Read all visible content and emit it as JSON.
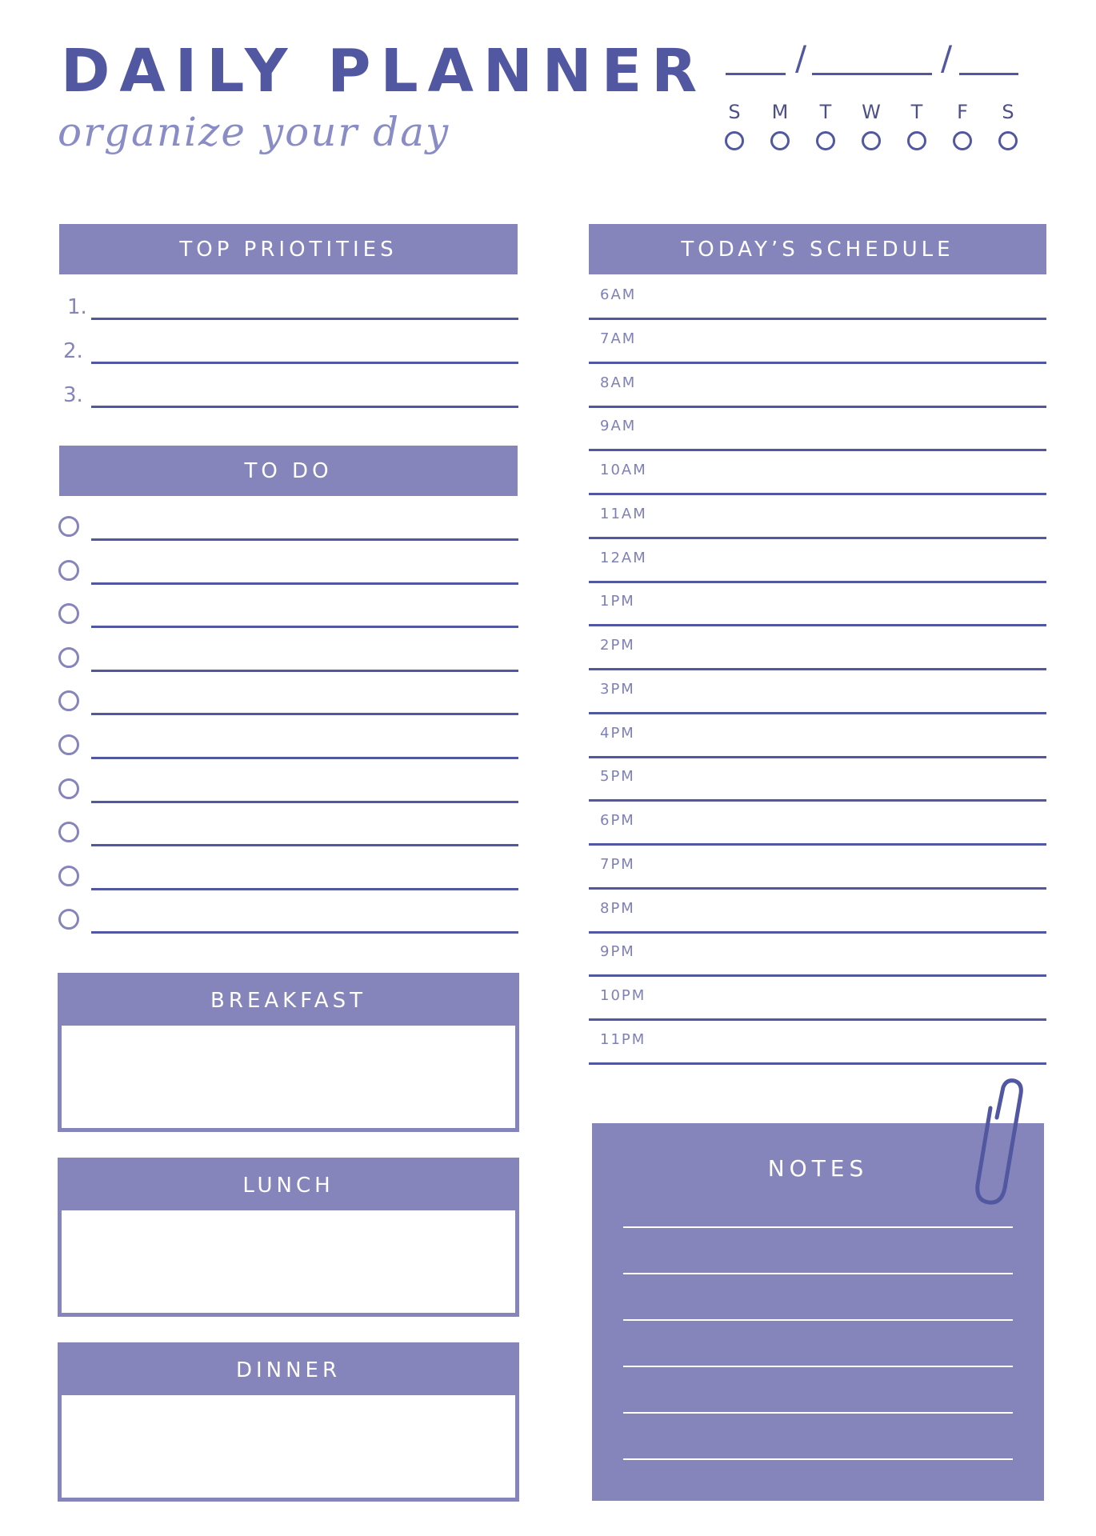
{
  "header": {
    "title": "DAILY PLANNER",
    "subtitle": "organize your day",
    "date_separators": [
      "/",
      "/"
    ],
    "weekdays": [
      "S",
      "M",
      "T",
      "W",
      "T",
      "F",
      "S"
    ]
  },
  "priorities": {
    "title": "TOP PRIOTITIES",
    "items": [
      "1.",
      "2.",
      "3."
    ]
  },
  "todo": {
    "title": "TO DO",
    "count": 10
  },
  "meals": [
    {
      "title": "BREAKFAST"
    },
    {
      "title": "LUNCH"
    },
    {
      "title": "DINNER"
    }
  ],
  "schedule": {
    "title": "TODAY’S SCHEDULE",
    "times": [
      "6AM",
      "7AM",
      "8AM",
      "9AM",
      "10AM",
      "11AM",
      "12AM",
      "1PM",
      "2PM",
      "3PM",
      "4PM",
      "5PM",
      "6PM",
      "7PM",
      "8PM",
      "9PM",
      "10PM",
      "11PM"
    ]
  },
  "notes": {
    "title": "NOTES",
    "line_count": 6,
    "icon": "paperclip-icon"
  },
  "colors": {
    "accent_dark": "#5157a0",
    "accent_fill": "#8585bc",
    "script": "#8a8cc6"
  }
}
